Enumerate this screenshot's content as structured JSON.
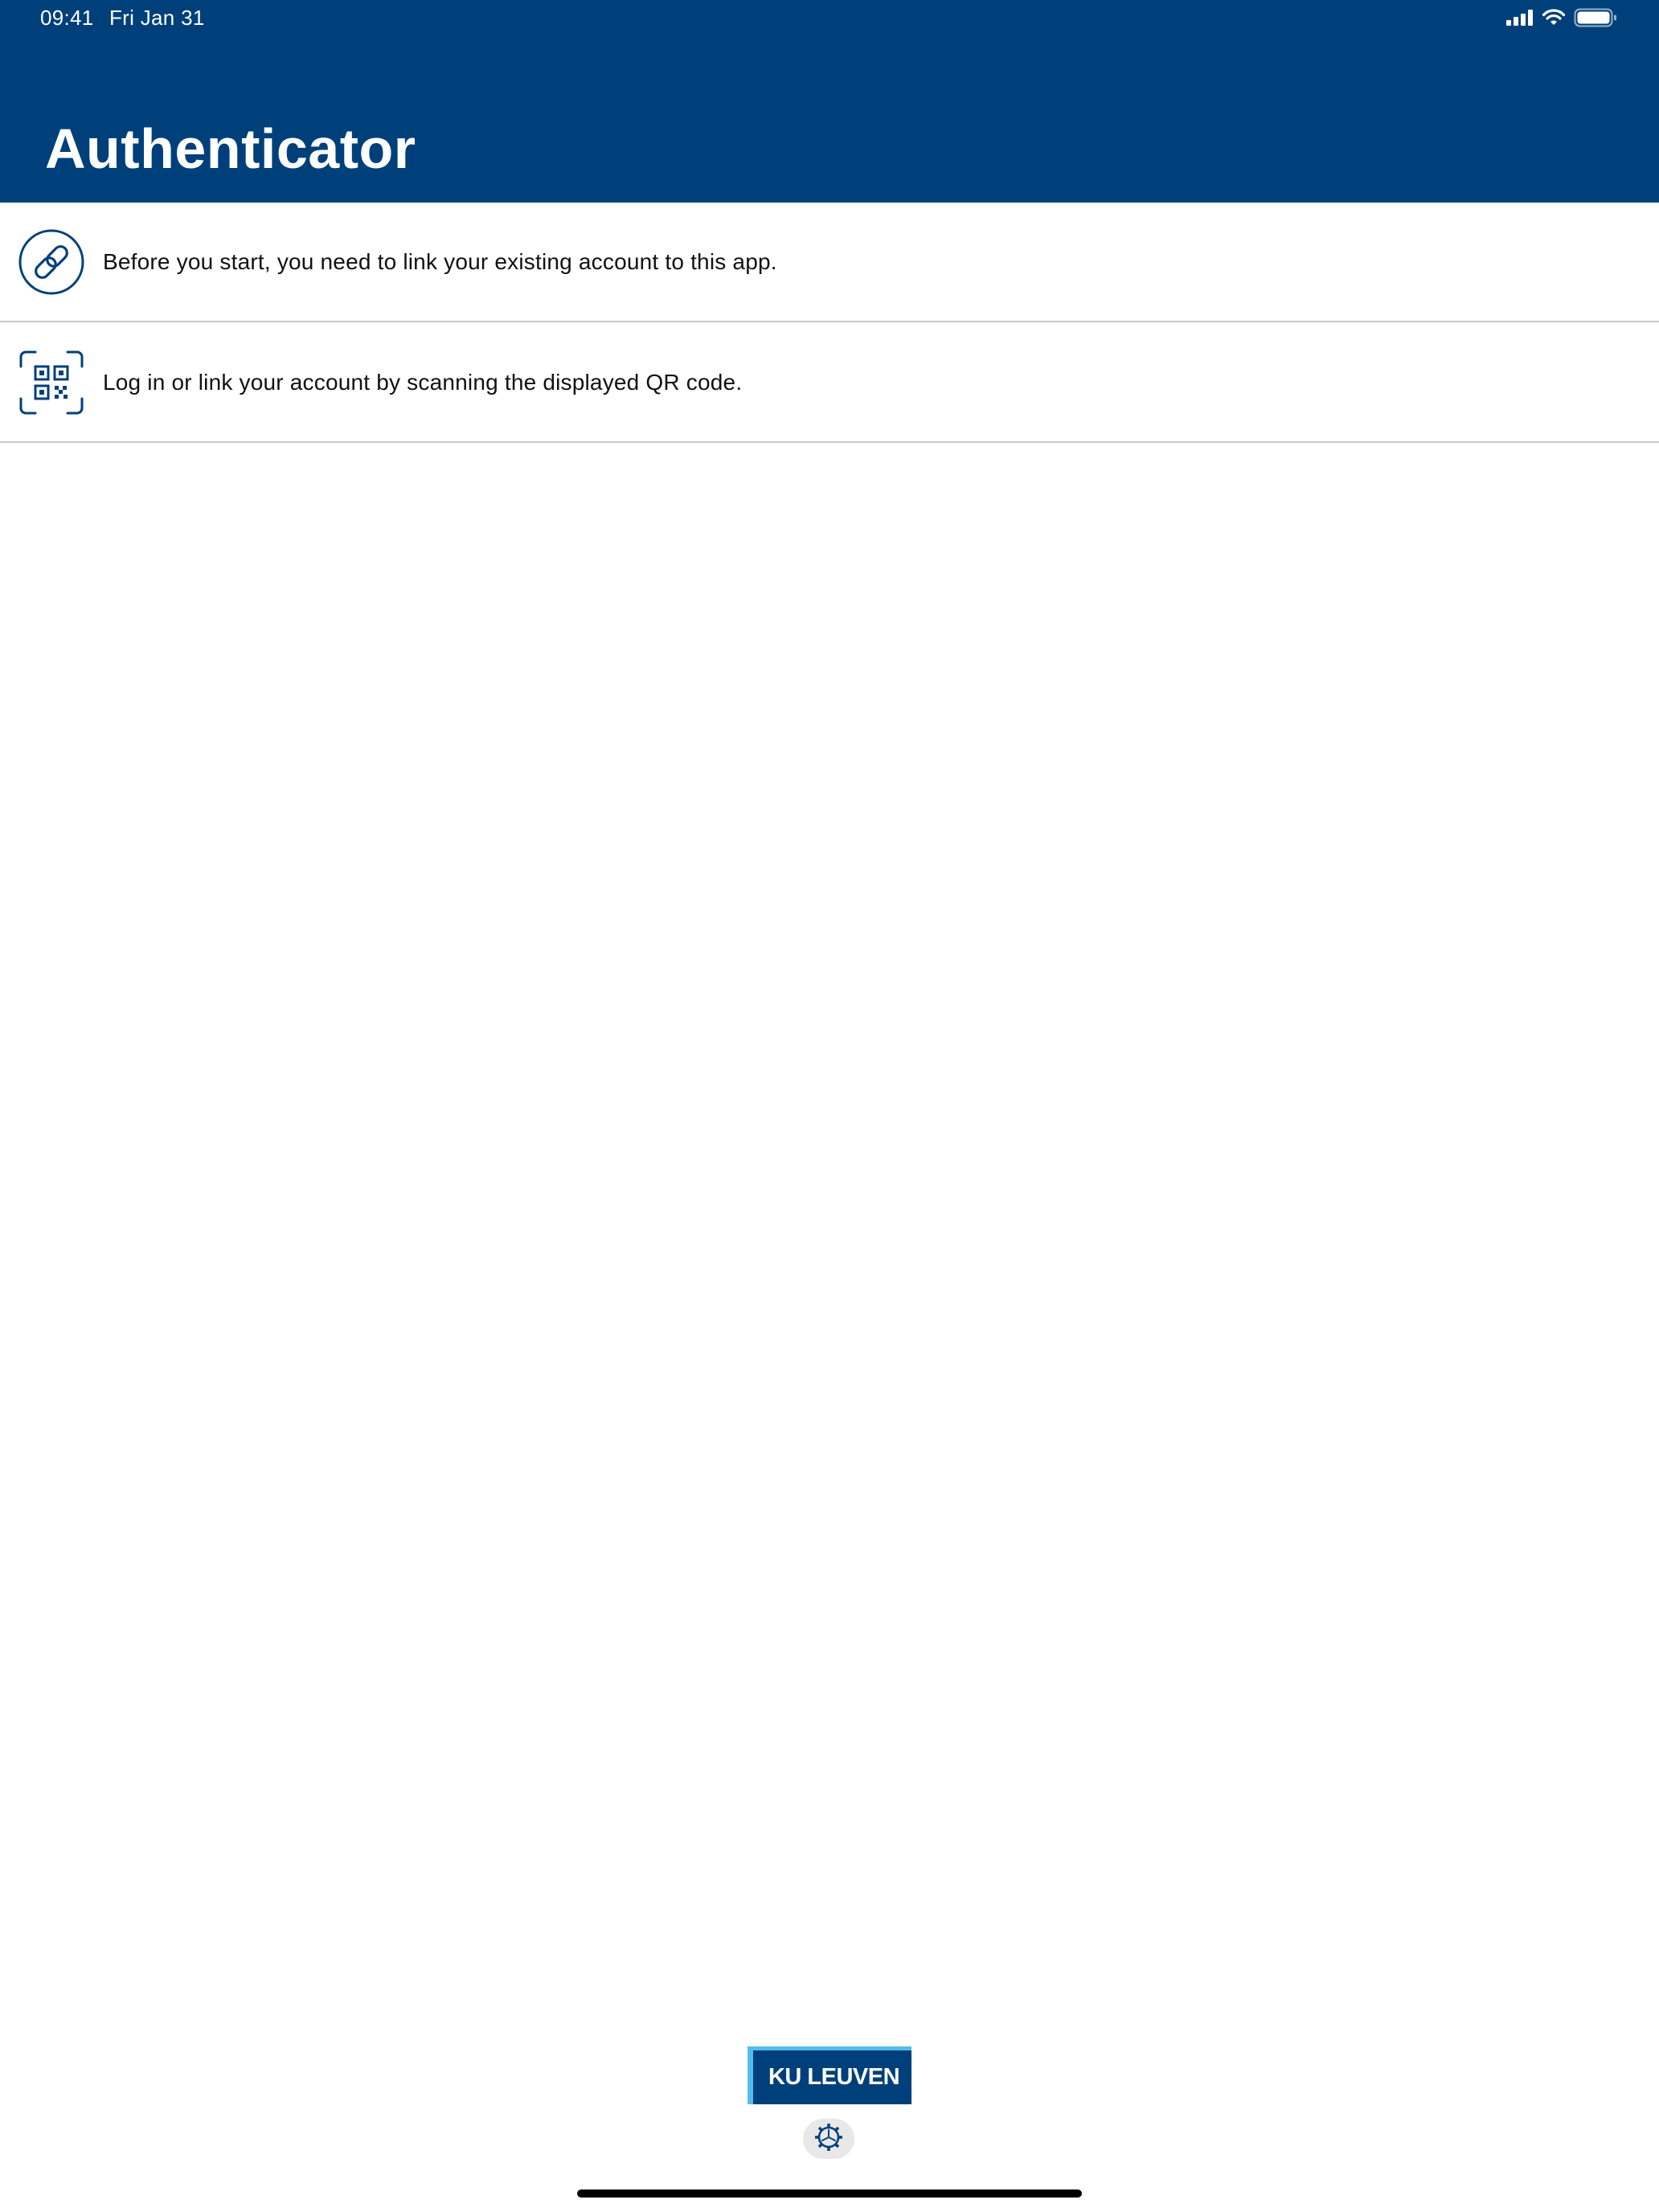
{
  "status_bar": {
    "time": "09:41",
    "date": "Fri Jan 31"
  },
  "header": {
    "title": "Authenticator"
  },
  "rows": [
    {
      "icon": "link-icon",
      "text": "Before you start, you need to link your existing account to this app."
    },
    {
      "icon": "qr-code-scan-icon",
      "text": "Log in or link your account by scanning the displayed QR code."
    }
  ],
  "footer": {
    "logo_text": "KU LEUVEN",
    "settings_icon": "gear-icon"
  },
  "colors": {
    "brand_blue": "#00407a",
    "accent_light_blue": "#52bdec",
    "divider": "#c8c8c8"
  }
}
